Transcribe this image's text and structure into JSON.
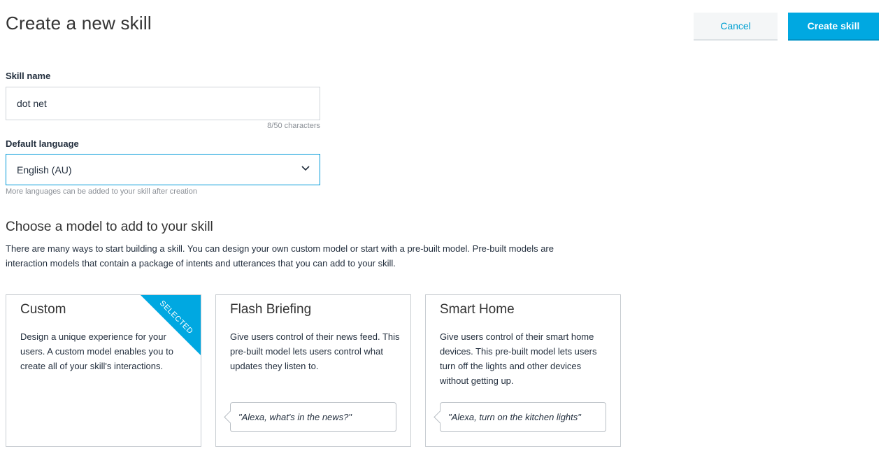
{
  "header": {
    "title": "Create a new skill",
    "cancel_label": "Cancel",
    "create_label": "Create skill"
  },
  "skill_name": {
    "label": "Skill name",
    "value": "dot net",
    "char_count": "8/50  characters"
  },
  "language": {
    "label": "Default language",
    "selected": "English (AU)",
    "hint": "More languages can be added to your skill after creation"
  },
  "model_section": {
    "title": "Choose a model to add to your skill",
    "description": "There are many ways to start building a skill. You can design your own custom model or start with a pre-built model.  Pre-built models are interaction models that contain a package of intents and utterances that you can add to your skill."
  },
  "models": [
    {
      "title": "Custom",
      "description": "Design a unique experience for your users. A custom model enables you to create all of your skill's interactions.",
      "badge": "SELECTED"
    },
    {
      "title": "Flash Briefing",
      "description": "Give users control of their news feed. This pre-built model lets users control what updates they listen to.",
      "example": "\"Alexa, what's in the news?\""
    },
    {
      "title": "Smart Home",
      "description": "Give users control of their smart home devices. This pre-built model lets users turn off the lights and other devices without getting up.",
      "example": "\"Alexa, turn on the kitchen lights\""
    }
  ],
  "colors": {
    "accent": "#00a8e1",
    "link": "#00a0d2",
    "border": "#c8cdd2"
  }
}
